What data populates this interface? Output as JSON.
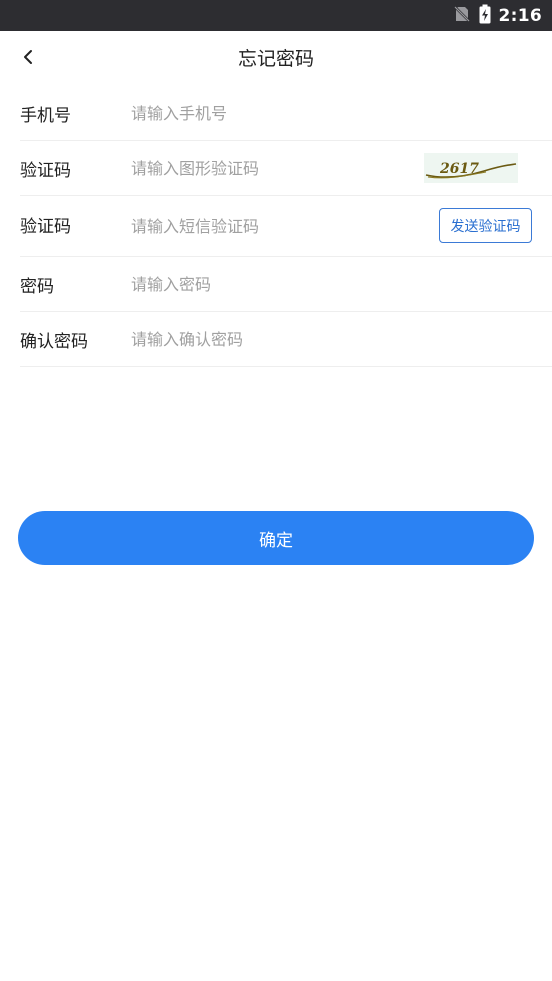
{
  "status_bar": {
    "time": "2:16",
    "icons": [
      "no-sim-icon",
      "battery-charging-icon"
    ],
    "background": "#2d2d31"
  },
  "header": {
    "title": "忘记密码",
    "back_icon": "chevron-left-icon"
  },
  "form": {
    "phone": {
      "label": "手机号",
      "placeholder": "请输入手机号"
    },
    "image_captcha": {
      "label": "验证码",
      "placeholder": "请输入图形验证码",
      "captcha_text": "2617"
    },
    "sms_code": {
      "label": "验证码",
      "placeholder": "请输入短信验证码",
      "send_button_label": "发送验证码"
    },
    "password": {
      "label": "密码",
      "placeholder": "请输入密码"
    },
    "confirm_password": {
      "label": "确认密码",
      "placeholder": "请输入确认密码"
    }
  },
  "confirm_button": {
    "label": "确定",
    "color": "#2b82f3"
  },
  "colors": {
    "accent": "#2b82f3",
    "outline_button": "#3b7ad6",
    "divider": "#eeeeee",
    "placeholder": "#a0a0a0"
  }
}
